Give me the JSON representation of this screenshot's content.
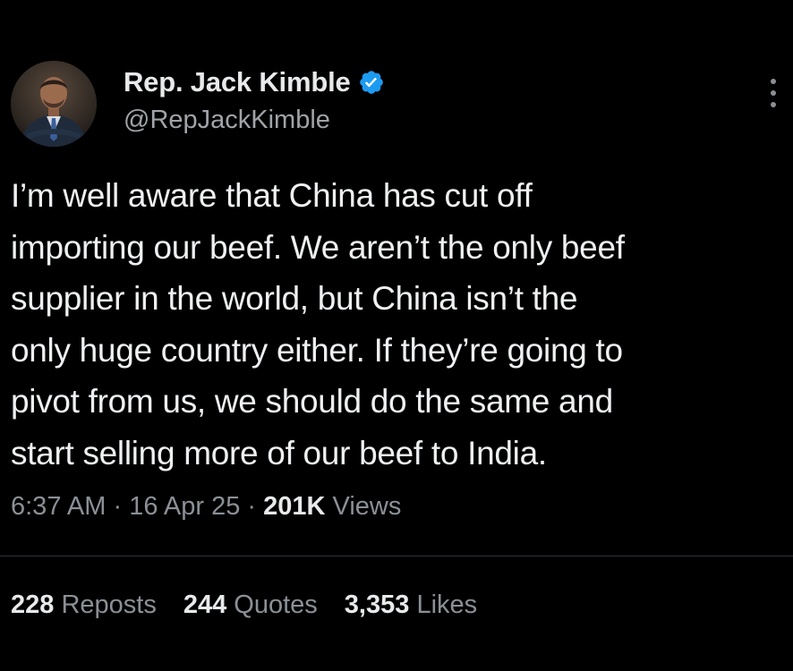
{
  "author": {
    "display_name": "Rep. Jack Kimble",
    "handle": "@RepJackKimble",
    "verified_icon": "verified-badge-icon",
    "avatar": "profile-photo"
  },
  "tweet": {
    "text": "I’m well aware that China has cut off\nimporting our beef. We aren’t the only beef\nsupplier in the world, but China isn’t the\nonly huge country either. If they’re going to\npivot from us, we should do the same and\nstart selling more of our beef to India.",
    "time": "6:37 AM",
    "date": "16 Apr 25",
    "separator": "·",
    "views_count": "201K",
    "views_label": "Views"
  },
  "stats": {
    "reposts_count": "228",
    "reposts_label": "Reposts",
    "quotes_count": "244",
    "quotes_label": "Quotes",
    "likes_count": "3,353",
    "likes_label": "Likes"
  },
  "colors": {
    "background": "#000000",
    "primary_text": "#e7e9ea",
    "secondary_text": "#8b9096",
    "verified_blue": "#1d9bf0",
    "divider": "#2f3336"
  }
}
